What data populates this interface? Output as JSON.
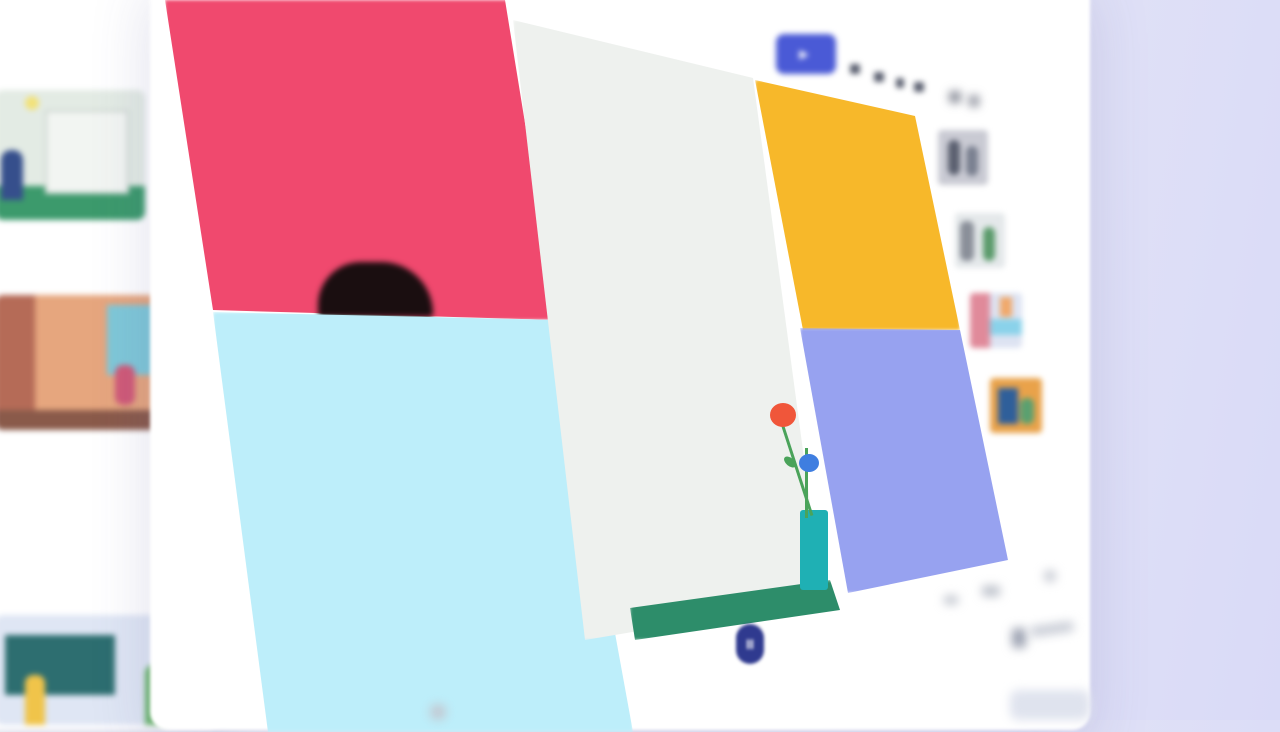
{
  "sidebar": {
    "items": [
      {
        "label": ""
      },
      {
        "label": ""
      },
      {
        "label": ""
      }
    ]
  },
  "toolbar": {
    "present_label": "",
    "tools": [
      "bold-icon",
      "italic-icon",
      "underline-icon",
      "align-icon",
      "list-icon",
      "more-icon"
    ]
  },
  "player": {
    "pause_symbol": "II"
  },
  "colors": {
    "accent": "#4a5ad6",
    "pink": "#f0496e",
    "light_blue": "#bdeefa",
    "off_white": "#eef1ee",
    "yellow": "#f7b82a",
    "lavender": "#97a2f0",
    "green": "#2d8d6a",
    "teal": "#1fb0b4"
  }
}
